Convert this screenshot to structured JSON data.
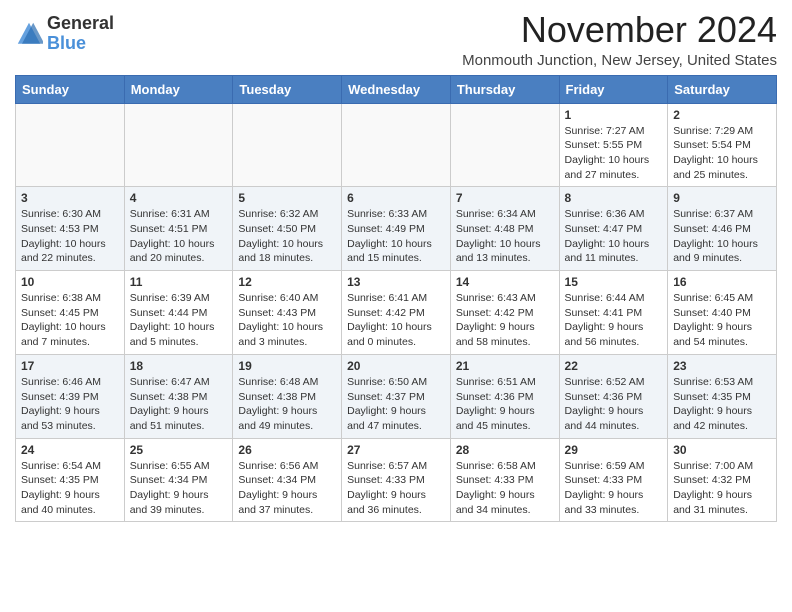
{
  "header": {
    "logo_general": "General",
    "logo_blue": "Blue",
    "month_title": "November 2024",
    "location": "Monmouth Junction, New Jersey, United States"
  },
  "days_of_week": [
    "Sunday",
    "Monday",
    "Tuesday",
    "Wednesday",
    "Thursday",
    "Friday",
    "Saturday"
  ],
  "weeks": [
    {
      "row_class": "row-odd",
      "days": [
        {
          "num": "",
          "empty": true,
          "detail": ""
        },
        {
          "num": "",
          "empty": true,
          "detail": ""
        },
        {
          "num": "",
          "empty": true,
          "detail": ""
        },
        {
          "num": "",
          "empty": true,
          "detail": ""
        },
        {
          "num": "",
          "empty": true,
          "detail": ""
        },
        {
          "num": "1",
          "empty": false,
          "detail": "Sunrise: 7:27 AM\nSunset: 5:55 PM\nDaylight: 10 hours and 27 minutes."
        },
        {
          "num": "2",
          "empty": false,
          "detail": "Sunrise: 7:29 AM\nSunset: 5:54 PM\nDaylight: 10 hours and 25 minutes."
        }
      ]
    },
    {
      "row_class": "row-even",
      "days": [
        {
          "num": "3",
          "empty": false,
          "detail": "Sunrise: 6:30 AM\nSunset: 4:53 PM\nDaylight: 10 hours and 22 minutes."
        },
        {
          "num": "4",
          "empty": false,
          "detail": "Sunrise: 6:31 AM\nSunset: 4:51 PM\nDaylight: 10 hours and 20 minutes."
        },
        {
          "num": "5",
          "empty": false,
          "detail": "Sunrise: 6:32 AM\nSunset: 4:50 PM\nDaylight: 10 hours and 18 minutes."
        },
        {
          "num": "6",
          "empty": false,
          "detail": "Sunrise: 6:33 AM\nSunset: 4:49 PM\nDaylight: 10 hours and 15 minutes."
        },
        {
          "num": "7",
          "empty": false,
          "detail": "Sunrise: 6:34 AM\nSunset: 4:48 PM\nDaylight: 10 hours and 13 minutes."
        },
        {
          "num": "8",
          "empty": false,
          "detail": "Sunrise: 6:36 AM\nSunset: 4:47 PM\nDaylight: 10 hours and 11 minutes."
        },
        {
          "num": "9",
          "empty": false,
          "detail": "Sunrise: 6:37 AM\nSunset: 4:46 PM\nDaylight: 10 hours and 9 minutes."
        }
      ]
    },
    {
      "row_class": "row-odd",
      "days": [
        {
          "num": "10",
          "empty": false,
          "detail": "Sunrise: 6:38 AM\nSunset: 4:45 PM\nDaylight: 10 hours and 7 minutes."
        },
        {
          "num": "11",
          "empty": false,
          "detail": "Sunrise: 6:39 AM\nSunset: 4:44 PM\nDaylight: 10 hours and 5 minutes."
        },
        {
          "num": "12",
          "empty": false,
          "detail": "Sunrise: 6:40 AM\nSunset: 4:43 PM\nDaylight: 10 hours and 3 minutes."
        },
        {
          "num": "13",
          "empty": false,
          "detail": "Sunrise: 6:41 AM\nSunset: 4:42 PM\nDaylight: 10 hours and 0 minutes."
        },
        {
          "num": "14",
          "empty": false,
          "detail": "Sunrise: 6:43 AM\nSunset: 4:42 PM\nDaylight: 9 hours and 58 minutes."
        },
        {
          "num": "15",
          "empty": false,
          "detail": "Sunrise: 6:44 AM\nSunset: 4:41 PM\nDaylight: 9 hours and 56 minutes."
        },
        {
          "num": "16",
          "empty": false,
          "detail": "Sunrise: 6:45 AM\nSunset: 4:40 PM\nDaylight: 9 hours and 54 minutes."
        }
      ]
    },
    {
      "row_class": "row-even",
      "days": [
        {
          "num": "17",
          "empty": false,
          "detail": "Sunrise: 6:46 AM\nSunset: 4:39 PM\nDaylight: 9 hours and 53 minutes."
        },
        {
          "num": "18",
          "empty": false,
          "detail": "Sunrise: 6:47 AM\nSunset: 4:38 PM\nDaylight: 9 hours and 51 minutes."
        },
        {
          "num": "19",
          "empty": false,
          "detail": "Sunrise: 6:48 AM\nSunset: 4:38 PM\nDaylight: 9 hours and 49 minutes."
        },
        {
          "num": "20",
          "empty": false,
          "detail": "Sunrise: 6:50 AM\nSunset: 4:37 PM\nDaylight: 9 hours and 47 minutes."
        },
        {
          "num": "21",
          "empty": false,
          "detail": "Sunrise: 6:51 AM\nSunset: 4:36 PM\nDaylight: 9 hours and 45 minutes."
        },
        {
          "num": "22",
          "empty": false,
          "detail": "Sunrise: 6:52 AM\nSunset: 4:36 PM\nDaylight: 9 hours and 44 minutes."
        },
        {
          "num": "23",
          "empty": false,
          "detail": "Sunrise: 6:53 AM\nSunset: 4:35 PM\nDaylight: 9 hours and 42 minutes."
        }
      ]
    },
    {
      "row_class": "row-odd",
      "days": [
        {
          "num": "24",
          "empty": false,
          "detail": "Sunrise: 6:54 AM\nSunset: 4:35 PM\nDaylight: 9 hours and 40 minutes."
        },
        {
          "num": "25",
          "empty": false,
          "detail": "Sunrise: 6:55 AM\nSunset: 4:34 PM\nDaylight: 9 hours and 39 minutes."
        },
        {
          "num": "26",
          "empty": false,
          "detail": "Sunrise: 6:56 AM\nSunset: 4:34 PM\nDaylight: 9 hours and 37 minutes."
        },
        {
          "num": "27",
          "empty": false,
          "detail": "Sunrise: 6:57 AM\nSunset: 4:33 PM\nDaylight: 9 hours and 36 minutes."
        },
        {
          "num": "28",
          "empty": false,
          "detail": "Sunrise: 6:58 AM\nSunset: 4:33 PM\nDaylight: 9 hours and 34 minutes."
        },
        {
          "num": "29",
          "empty": false,
          "detail": "Sunrise: 6:59 AM\nSunset: 4:33 PM\nDaylight: 9 hours and 33 minutes."
        },
        {
          "num": "30",
          "empty": false,
          "detail": "Sunrise: 7:00 AM\nSunset: 4:32 PM\nDaylight: 9 hours and 31 minutes."
        }
      ]
    }
  ]
}
